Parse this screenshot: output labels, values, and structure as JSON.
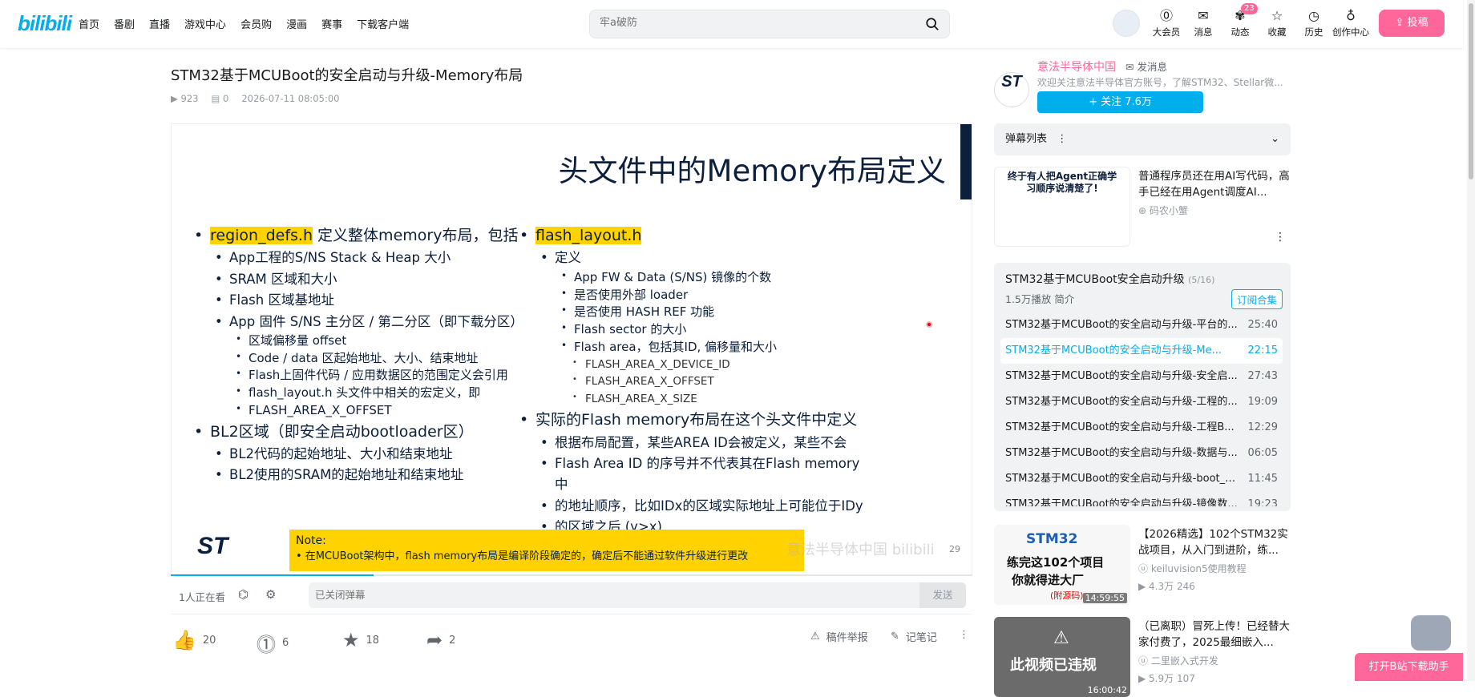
{
  "header": {
    "logo": "bilibili",
    "nav": [
      "首页",
      "番剧",
      "直播",
      "游戏中心",
      "会员购",
      "漫画",
      "赛事",
      "下载客户端"
    ],
    "search_placeholder": "牢a破防",
    "right_items": [
      {
        "label": "大会员",
        "icon": "vip-icon"
      },
      {
        "label": "消息",
        "icon": "message-icon"
      },
      {
        "label": "动态",
        "icon": "dynamic-icon",
        "badge": "23"
      },
      {
        "label": "收藏",
        "icon": "star-icon"
      },
      {
        "label": "历史",
        "icon": "clock-icon"
      },
      {
        "label": "创作中心",
        "icon": "bulb-icon"
      }
    ],
    "upload_label": "投稿"
  },
  "video": {
    "title": "STM32基于MCUBoot的安全启动与升级-Memory布局",
    "plays": "923",
    "danmaku": "0",
    "date": "2026-07-11 08:05:00"
  },
  "slide": {
    "title": "头文件中的Memory布局定义",
    "left": {
      "l1_hl": "region_defs.h",
      "l1_rest": " 定义整体memory布局，包括",
      "items": [
        {
          "lvl": 2,
          "text": "App工程的S/NS Stack & Heap 大小"
        },
        {
          "lvl": 2,
          "text": "SRAM 区域和大小"
        },
        {
          "lvl": 2,
          "text": "Flash 区域基地址"
        },
        {
          "lvl": 2,
          "text": "App 固件 S/NS 主分区 / 第二分区（即下载分区）"
        },
        {
          "lvl": 3,
          "text": "区域偏移量 offset"
        },
        {
          "lvl": 3,
          "text": "Code / data 区起始地址、大小、结束地址"
        },
        {
          "lvl": 3,
          "text": "Flash上固件代码 / 应用数据区的范围定义会引用"
        },
        {
          "lvl": 3,
          "text": "flash_layout.h 头文件中相关的宏定义，即"
        },
        {
          "lvl": 3,
          "text": "FLASH_AREA_X_OFFSET"
        },
        {
          "lvl": 1,
          "text": "BL2区域（即安全启动bootloader区）"
        },
        {
          "lvl": 2,
          "text": "BL2代码的起始地址、大小和结束地址"
        },
        {
          "lvl": 2,
          "text": "BL2使用的SRAM的起始地址和结束地址"
        }
      ]
    },
    "right": {
      "l1_hl": "flash_layout.h",
      "items": [
        {
          "lvl": 2,
          "text": "定义"
        },
        {
          "lvl": 3,
          "text": "App FW & Data (S/NS) 镜像的个数"
        },
        {
          "lvl": 3,
          "text": "是否使用外部 loader"
        },
        {
          "lvl": 3,
          "text": "是否使用 HASH REF 功能"
        },
        {
          "lvl": 3,
          "text": "Flash sector 的大小"
        },
        {
          "lvl": 3,
          "text": "Flash area，包括其ID, 偏移量和大小"
        },
        {
          "lvl": 4,
          "text": "FLASH_AREA_X_DEVICE_ID"
        },
        {
          "lvl": 4,
          "text": "FLASH_AREA_X_OFFSET"
        },
        {
          "lvl": 4,
          "text": "FLASH_AREA_X_SIZE"
        },
        {
          "lvl": 1,
          "text": "实际的Flash memory布局在这个头文件中定义"
        },
        {
          "lvl": 2,
          "text": "根据布局配置，某些AREA ID会被定义，某些不会"
        },
        {
          "lvl": 2,
          "text": "Flash Area ID 的序号并不代表其在Flash memory中"
        },
        {
          "lvl": 2,
          "text": "的地址顺序，比如IDx的区域实际地址上可能位于IDy"
        },
        {
          "lvl": 2,
          "text": "的区域之后 (y>x)"
        }
      ]
    },
    "note_title": "Note:",
    "note_text": "•    在MCUBoot架构中，flash memory布局是编译阶段确定的，确定后不能通过软件升级进行更改",
    "logo": "ST",
    "page": "29",
    "watermark": "意法半导体中国  bilibili"
  },
  "player": {
    "progress": 0.253,
    "watching": "1人正在看",
    "dm_placeholder": "已关闭弹幕",
    "send_label": "发送"
  },
  "toolbar": {
    "like": "20",
    "coin": "6",
    "fav": "18",
    "share": "2",
    "report": "稿件举报",
    "notes": "记笔记"
  },
  "uploader": {
    "name": "意法半导体中国",
    "msg": "发消息",
    "desc": "欢迎关注意法半导体官方账号，了解STM32、Stellar微...",
    "follow": "+ 关注 7.6万"
  },
  "danmaku_list": {
    "label": "弹幕列表"
  },
  "rec1": {
    "title": "普通程序员还在用AI写代码，高手已经在用Agent调度AI...",
    "author": "码农小蟹",
    "thumb_text": "终于有人把Agent正确学习顺序说清楚了!"
  },
  "collection": {
    "title": "STM32基于MCUBoot安全启动升级",
    "count": "(5/16)",
    "meta": "1.5万播放  简介",
    "subscribe": "订阅合集",
    "episodes": [
      {
        "t": "STM32基于MCUBoot的安全启动与升级-平台的...",
        "d": "25:40"
      },
      {
        "t": "STM32基于MCUBoot的安全启动与升级-Me...",
        "d": "22:15",
        "active": true
      },
      {
        "t": "STM32基于MCUBoot的安全启动与升级-安全启...",
        "d": "27:43"
      },
      {
        "t": "STM32基于MCUBoot的安全启动与升级-工程的...",
        "d": "19:09"
      },
      {
        "t": "STM32基于MCUBoot的安全启动与升级-工程B...",
        "d": "12:29"
      },
      {
        "t": "STM32基于MCUBoot的安全启动与升级-数据与...",
        "d": "06:05"
      },
      {
        "t": "STM32基于MCUBoot的安全启动与升级-boot_g...",
        "d": "11:45"
      },
      {
        "t": "STM32基于MCUBoot的安全启动与升级-镜像数...",
        "d": "19:23"
      }
    ]
  },
  "rec2": {
    "title": "【2026精选】102个STM32实战项目，从入门到进阶，练...",
    "author": "keiluvision5使用教程",
    "stats": "4.3万   246",
    "duration": "14:59:55",
    "thumb_top": "STM32",
    "thumb_mid": "练完这102个项目",
    "thumb_bot": "你就得进大厂",
    "thumb_sub": "(附源码)"
  },
  "rec3": {
    "title": "（已离职）冒死上传！已经替大家付费了，2025最细嵌入...",
    "author": "二里嵌入式开发",
    "stats": "5.9万   107",
    "duration": "16:00:42",
    "thumb_text": "此视频已违规"
  },
  "open_app": "打开B站下载助手",
  "colors": {
    "brand_blue": "#00aeec",
    "brand_pink": "#ff6699",
    "slide_navy": "#0c1f3c",
    "highlight": "#ffd200"
  }
}
